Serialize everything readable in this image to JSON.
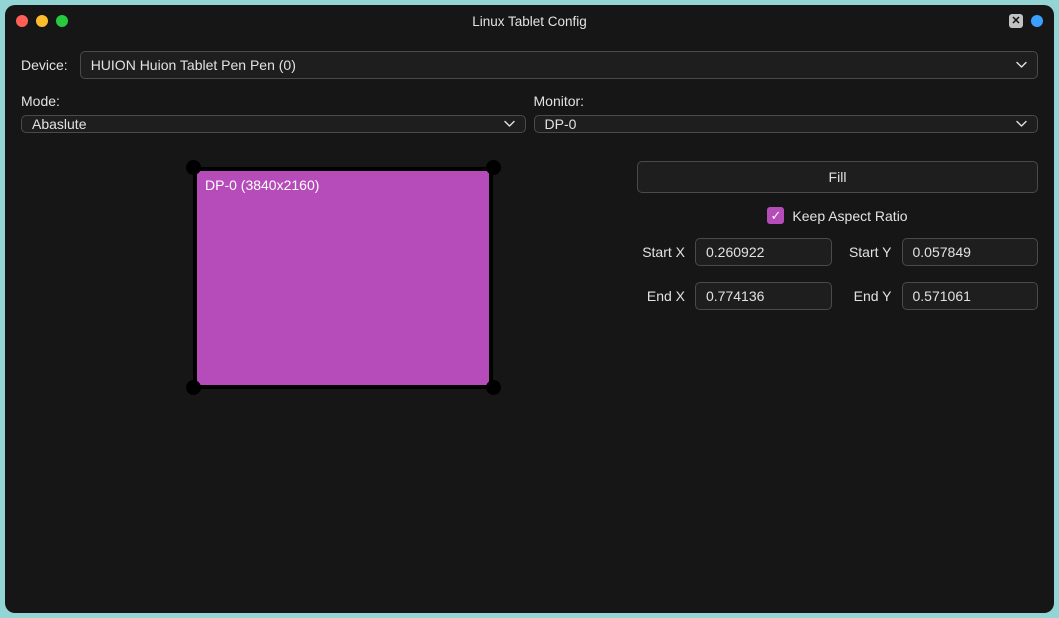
{
  "titlebar": {
    "title": "Linux Tablet Config"
  },
  "device": {
    "label": "Device:",
    "value": "HUION Huion Tablet Pen Pen (0)"
  },
  "mode": {
    "label": "Mode:",
    "value": "Abaslute"
  },
  "monitor": {
    "label": "Monitor:",
    "value": "DP-0"
  },
  "preview": {
    "display_label": "DP-0 (3840x2160)"
  },
  "controls": {
    "fill_label": "Fill",
    "keep_aspect_label": "Keep Aspect Ratio",
    "keep_aspect_checked": true,
    "start_x_label": "Start X",
    "start_x_value": "0.260922",
    "start_y_label": "Start Y",
    "start_y_value": "0.057849",
    "end_x_label": "End X",
    "end_x_value": "0.774136",
    "end_y_label": "End Y",
    "end_y_value": "0.571061"
  }
}
